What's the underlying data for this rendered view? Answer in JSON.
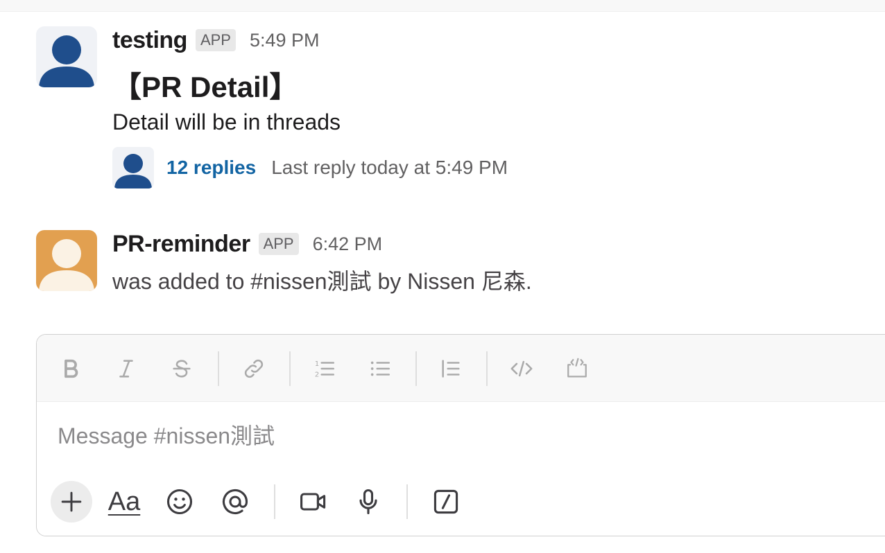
{
  "messages": [
    {
      "sender": "testing",
      "badge": "APP",
      "time": "5:49 PM",
      "heading": "【PR Detail】",
      "text": "Detail will be in threads",
      "thread": {
        "replies": "12 replies",
        "last_reply": "Last reply today at 5:49 PM"
      },
      "avatar_bg": "#f0f2f6",
      "avatar_fg": "#1f4e8c"
    },
    {
      "sender": "PR-reminder",
      "badge": "APP",
      "time": "6:42 PM",
      "text": "was added to #nissen測試 by Nissen 尼森.",
      "avatar_bg": "#e2a050",
      "avatar_fg": "#fbf2e4"
    }
  ],
  "composer": {
    "placeholder": "Message #nissen測試",
    "format_toolbar": [
      "bold-icon",
      "italic-icon",
      "strikethrough-icon",
      "link-icon",
      "ordered-list-icon",
      "bulleted-list-icon",
      "blockquote-icon",
      "code-icon",
      "code-block-icon"
    ],
    "bottom_toolbar": [
      "plus-icon",
      "formatting-icon",
      "emoji-icon",
      "mention-icon",
      "video-icon",
      "microphone-icon",
      "slash-command-icon"
    ],
    "formatting_label": "Aa"
  },
  "colors": {
    "link": "#1264a3",
    "badge_bg": "#e8e8e8",
    "toolbar_icon": "#aaaaaa",
    "bottom_icon": "#3d3c40"
  }
}
